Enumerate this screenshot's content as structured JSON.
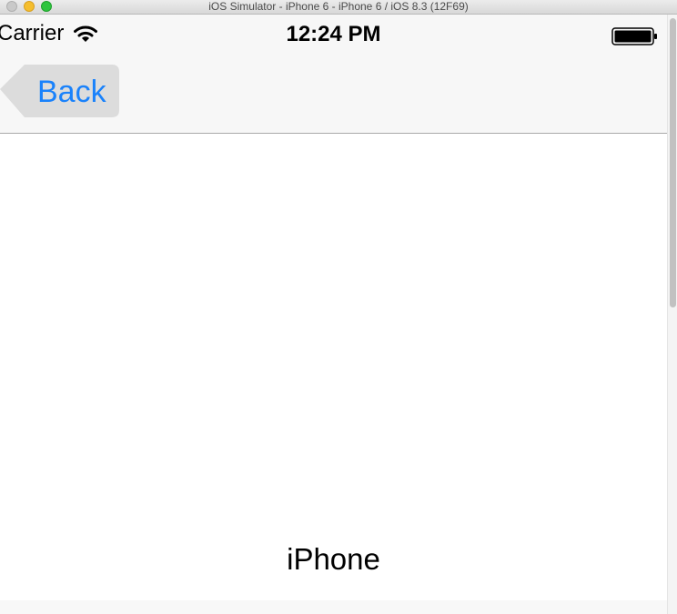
{
  "window": {
    "title": "iOS Simulator - iPhone 6 - iPhone 6 / iOS 8.3 (12F69)"
  },
  "status_bar": {
    "carrier": "Carrier",
    "time": "12:24 PM"
  },
  "nav_bar": {
    "back_label": "Back"
  },
  "content": {
    "label": "iPhone"
  },
  "colors": {
    "tint": "#1a82fb",
    "nav_background": "#f7f7f7",
    "back_button_background": "#dcdcdc"
  },
  "icons": {
    "wifi": "wifi-icon",
    "battery": "battery-icon"
  }
}
